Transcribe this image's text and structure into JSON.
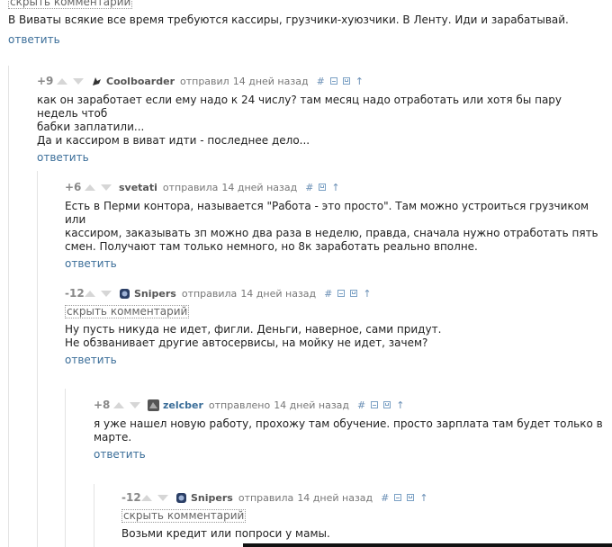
{
  "top": {
    "hide_label": "скрыть комментарии",
    "text": "В Виваты всякие все время требуются кассиры, грузчики-хуюзчики. В Ленту. Иди и зарабатывай.",
    "reply": "ответить"
  },
  "comments": [
    {
      "score": "+9",
      "author": "Coolboarder",
      "action": "отправил",
      "date": "14 дней назад",
      "tools": [
        "#",
        "−",
        "save",
        "↑"
      ],
      "lines": [
        "как он заработает если ему надо к 24 числу? там месяц надо отработать или хотя бы пару недель чтоб",
        "бабки заплатили...",
        "Да и кассиром в виват идти - последнее дело..."
      ],
      "reply": "ответить"
    },
    {
      "score": "+6",
      "author": "svetati",
      "action": "отправила",
      "date": "14 дней назад",
      "tools": [
        "#",
        "save",
        "↑"
      ],
      "lines": [
        "Есть в Перми контора, называется \"Работа - это просто\". Там можно устроиться грузчиком или",
        "кассиром, заказывать зп можно два раза в неделю, правда, сначала нужно отработать пять",
        "смен. Получают там только немного, но 8к заработать реально вполне."
      ],
      "reply": "ответить"
    },
    {
      "score": "-12",
      "author": "Snipers",
      "action": "отправила",
      "date": "14 дней назад",
      "tools": [
        "#",
        "−",
        "save",
        "↑"
      ],
      "hide_label": "скрыть комментарий",
      "lines": [
        "Ну пусть никуда не идет, фигли. Деньги, наверное, сами придут.",
        "Не обзванивает другие автосервисы, на мойку не идет, зачем?"
      ],
      "reply": "ответить"
    },
    {
      "score": "+8",
      "author": "zelcber",
      "action": "отправлено",
      "date": "14 дней назад",
      "tools": [
        "#",
        "−",
        "save",
        "↑"
      ],
      "lines": [
        "я уже нашел новую работу, прохожу там обучение. просто зарплата там будет только в",
        "марте."
      ],
      "reply": "ответить"
    },
    {
      "score": "-12",
      "author": "Snipers",
      "action": "отправила",
      "date": "14 дней назад",
      "tools": [
        "#",
        "−",
        "save",
        "↑"
      ],
      "hide_label": "скрыть комментарий",
      "lines": [
        "Возьми кредит или попроси у мамы."
      ]
    }
  ],
  "colors": {
    "link": "#3b6e99",
    "tool": "#6a8fb5",
    "thread": "#e3e3e3"
  }
}
